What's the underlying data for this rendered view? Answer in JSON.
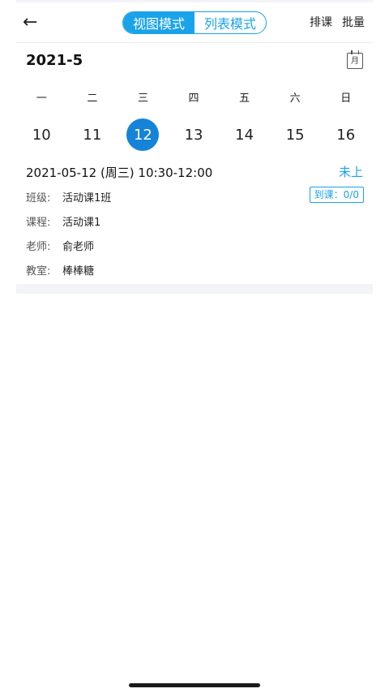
{
  "header": {
    "back_glyph": "←",
    "tabs": [
      {
        "label": "视图模式",
        "active": true
      },
      {
        "label": "列表模式",
        "active": false
      }
    ],
    "actions": {
      "schedule": "排课",
      "batch": "批量"
    }
  },
  "calendar": {
    "month_label": "2021-5",
    "month_icon_text": "月",
    "weekdays": [
      "一",
      "二",
      "三",
      "四",
      "五",
      "六",
      "日"
    ],
    "dates": [
      "10",
      "11",
      "12",
      "13",
      "14",
      "15",
      "16"
    ],
    "selected_date": "12",
    "accent_color": "#1583d8"
  },
  "lesson": {
    "time": "2021-05-12 (周三) 10:30-12:00",
    "status": "未上",
    "attendance": "到课：0/0",
    "rows": [
      {
        "key": "班级:",
        "value": "活动课1班"
      },
      {
        "key": "课程:",
        "value": "活动课1"
      },
      {
        "key": "老师:",
        "value": "俞老师"
      },
      {
        "key": "教室:",
        "value": "棒棒糖"
      }
    ]
  },
  "theme": {
    "primary": "#1aa3e8",
    "muted_bg": "#f3f4f8"
  }
}
